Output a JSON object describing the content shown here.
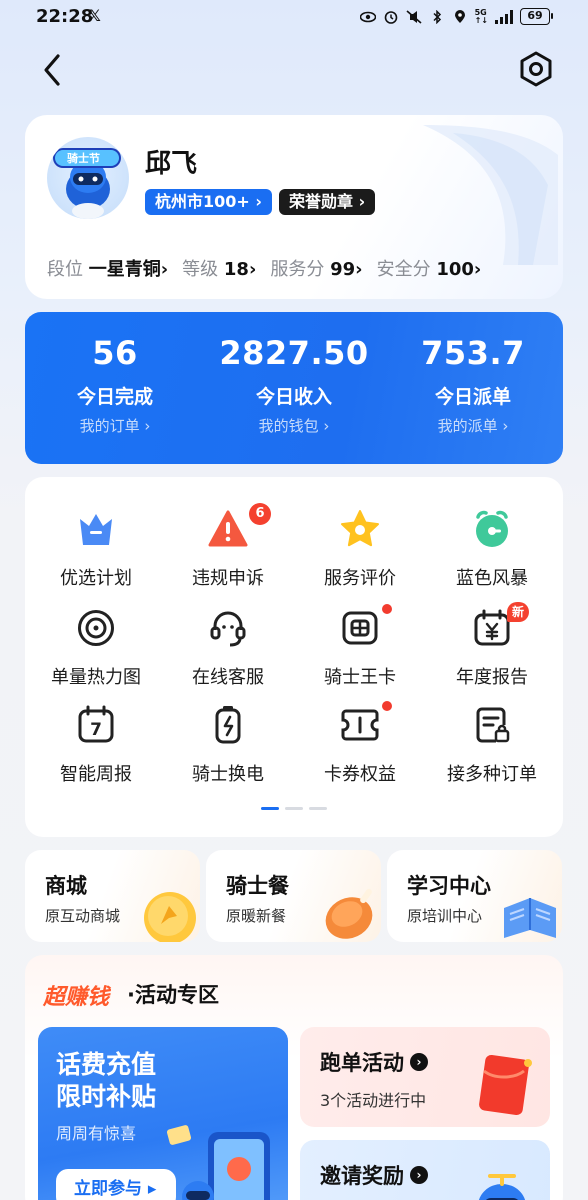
{
  "status_bar": {
    "time": "22:28",
    "x_logo": "𝕏",
    "battery": "69"
  },
  "profile": {
    "name": "邱飞",
    "city_tag": "杭州市100+",
    "honor_tag": "荣誉勋章",
    "stats": [
      {
        "label": "段位",
        "value": "一星青铜"
      },
      {
        "label": "等级",
        "value": "18"
      },
      {
        "label": "服务分",
        "value": "99"
      },
      {
        "label": "安全分",
        "value": "100"
      }
    ],
    "avatar_badge_text": "骑士节"
  },
  "summary": [
    {
      "value": "56",
      "label": "今日完成",
      "link": "我的订单"
    },
    {
      "value": "2827.50",
      "label": "今日收入",
      "link": "我的钱包"
    },
    {
      "value": "753.7",
      "label": "今日派单",
      "link": "我的派单"
    }
  ],
  "grid": [
    {
      "label": "优选计划",
      "icon": "crown-icon"
    },
    {
      "label": "违规申诉",
      "icon": "warning-icon",
      "badge": "6"
    },
    {
      "label": "服务评价",
      "icon": "star-icon"
    },
    {
      "label": "蓝色风暴",
      "icon": "alarm-clock-icon"
    },
    {
      "label": "单量热力图",
      "icon": "target-icon"
    },
    {
      "label": "在线客服",
      "icon": "headset-icon"
    },
    {
      "label": "骑士王卡",
      "icon": "sim-card-icon",
      "dot": true
    },
    {
      "label": "年度报告",
      "icon": "calendar-yuan-icon",
      "new_badge": "新"
    },
    {
      "label": "智能周报",
      "icon": "calendar-7-icon",
      "calendar_day": "7"
    },
    {
      "label": "骑士换电",
      "icon": "battery-swap-icon"
    },
    {
      "label": "卡券权益",
      "icon": "coupon-icon",
      "dot": true
    },
    {
      "label": "接多种订单",
      "icon": "order-doc-icon"
    }
  ],
  "shops": [
    {
      "title": "商城",
      "subtitle": "原互动商城"
    },
    {
      "title": "骑士餐",
      "subtitle": "原暖新餐"
    },
    {
      "title": "学习中心",
      "subtitle": "原培训中心"
    }
  ],
  "activity": {
    "hot_label": "超赚钱",
    "title": "·活动专区",
    "banner": {
      "line1": "话费充值",
      "line2": "限时补贴",
      "subtitle": "周周有惊喜",
      "button": "立即参与"
    },
    "tiles": [
      {
        "title": "跑单活动",
        "subtitle": "3个活动进行中"
      },
      {
        "title": "邀请奖励",
        "subtitle": ""
      }
    ]
  },
  "colors": {
    "primary_blue": "#1a6ef2",
    "badge_red": "#f4412f",
    "hot_orange": "#ff5a2c"
  }
}
